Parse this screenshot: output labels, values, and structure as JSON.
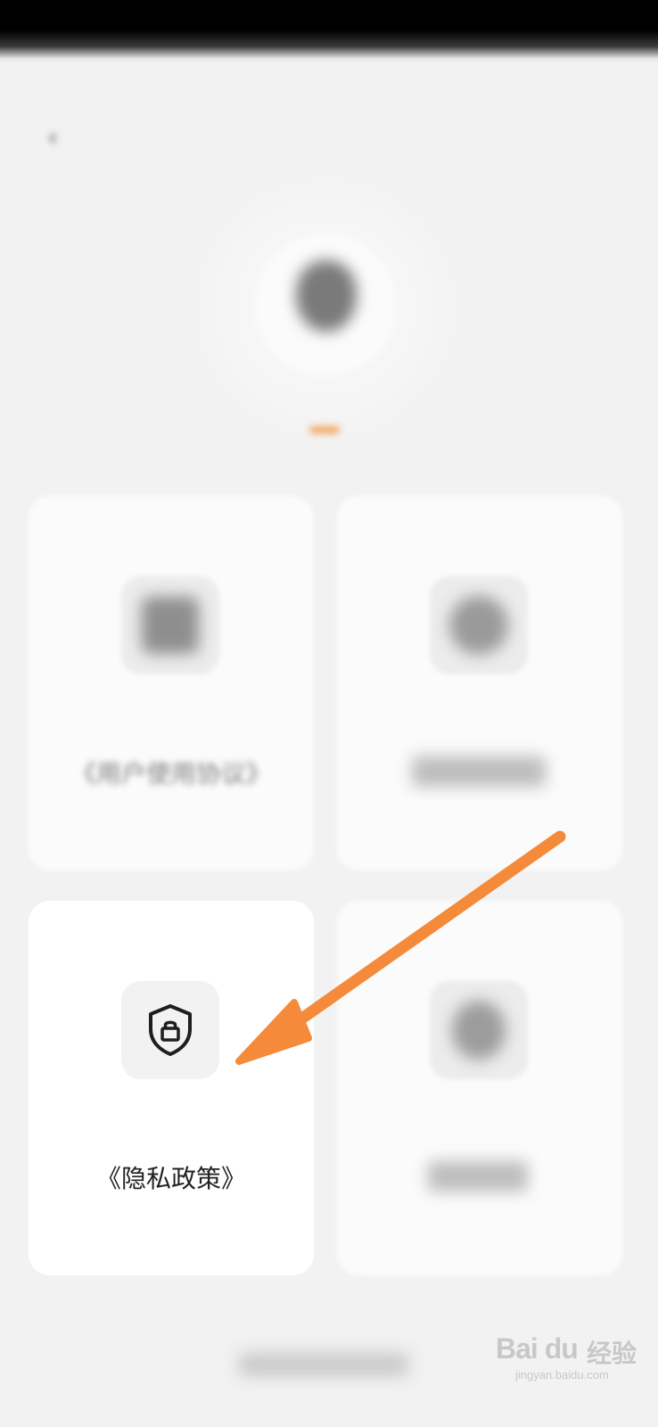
{
  "header": {
    "back_icon": "‹"
  },
  "profile": {
    "username": ""
  },
  "cards": [
    {
      "label": "《用户使用协议》",
      "icon": "document-icon"
    },
    {
      "label": "",
      "icon": "info-icon"
    },
    {
      "label": "《隐私政策》",
      "icon": "shield-lock-icon"
    },
    {
      "label": "",
      "icon": "circle-icon"
    }
  ],
  "watermark": {
    "brand": "Bai du",
    "text": "经验",
    "url": "jingyan.baidu.com"
  },
  "annotation": {
    "arrow_color": "#F58A3A"
  }
}
